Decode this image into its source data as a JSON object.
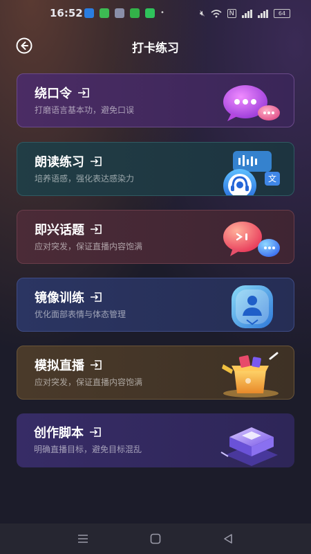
{
  "statusbar": {
    "time": "16:52",
    "battery": "64"
  },
  "header": {
    "title": "打卡练习"
  },
  "cards": [
    {
      "title": "绕口令",
      "subtitle": "打磨语言基本功，避免口误"
    },
    {
      "title": "朗读练习",
      "subtitle": "培养语感，强化表达感染力",
      "badge": "文"
    },
    {
      "title": "即兴话题",
      "subtitle": "应对突发，保证直播内容饱满"
    },
    {
      "title": "镜像训练",
      "subtitle": "优化面部表情与体态管理"
    },
    {
      "title": "模拟直播",
      "subtitle": "应对突发，保证直播内容饱满"
    },
    {
      "title": "创作脚本",
      "subtitle": "明确直播目标，避免目标混乱"
    }
  ]
}
